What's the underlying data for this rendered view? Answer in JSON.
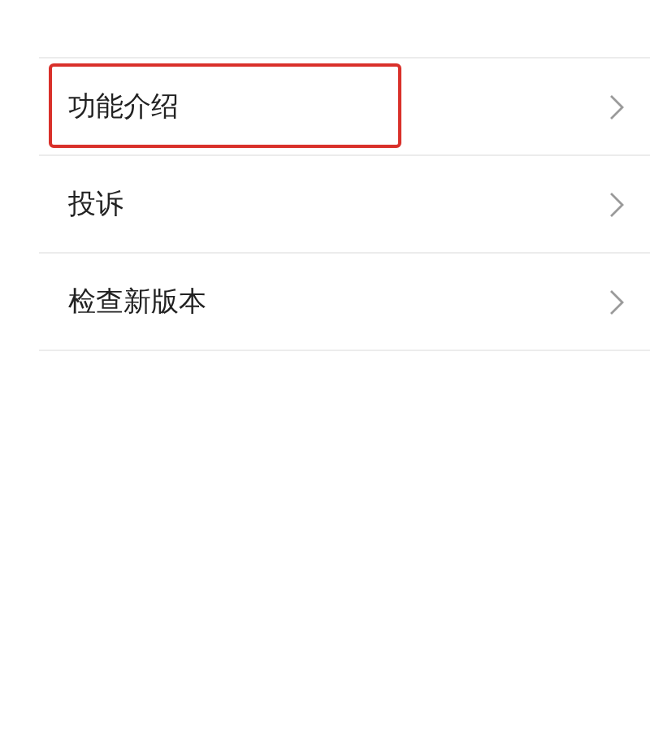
{
  "menu": [
    {
      "label": "功能介绍",
      "highlighted": true
    },
    {
      "label": "投诉",
      "highlighted": false
    },
    {
      "label": "检查新版本",
      "highlighted": false
    }
  ]
}
